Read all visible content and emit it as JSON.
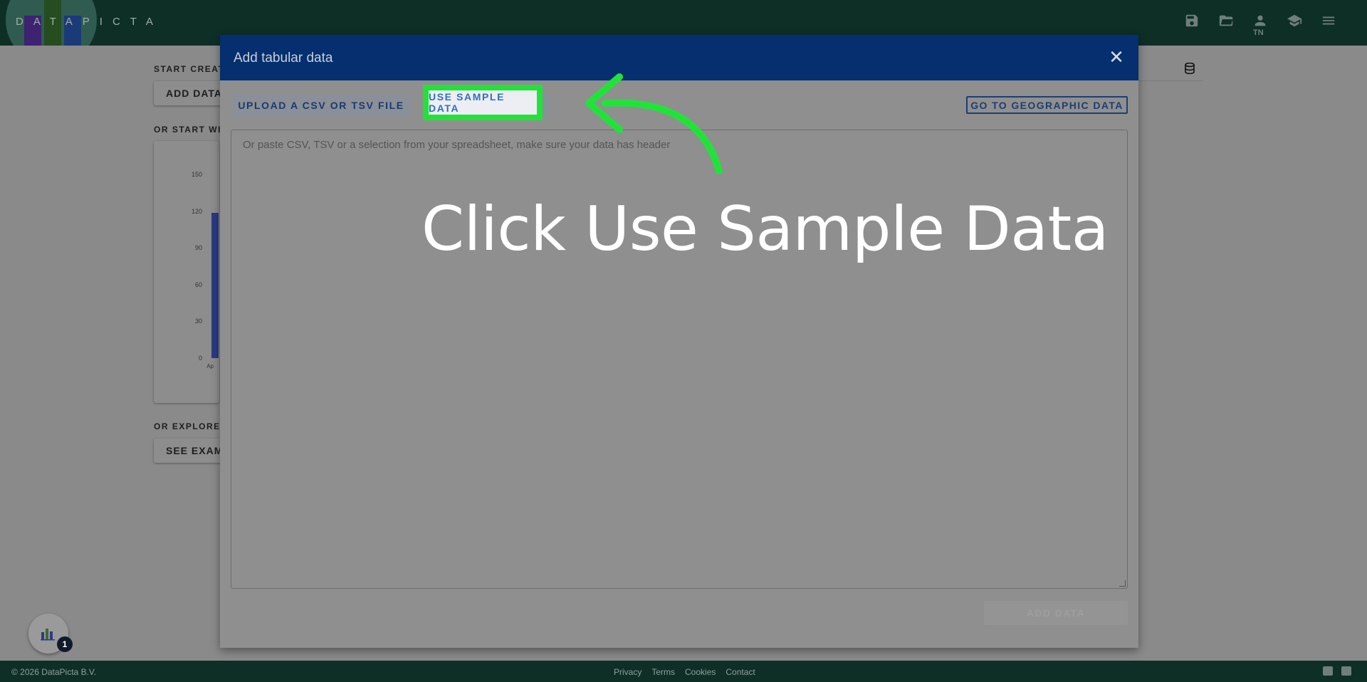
{
  "app": {
    "logo_text": "DATAPICTA",
    "icons": [
      "save-icon",
      "folder-open-icon",
      "account-icon",
      "school-icon",
      "menu-icon"
    ],
    "user_initials": "TN"
  },
  "background": {
    "start_label": "START CREAT",
    "add_data_label": "ADD DATA",
    "start_with_label": "OR START WI",
    "y_ticks": [
      "150",
      "120",
      "90",
      "60",
      "30",
      "0"
    ],
    "x_tick": "Ap",
    "explore_label": "OR EXPLORE",
    "see_examples_label": "SEE EXAM"
  },
  "modal": {
    "title": "Add tabular data",
    "close_glyph": "✕",
    "upload_label": "UPLOAD A CSV OR TSV FILE",
    "sample_label": "USE SAMPLE DATA",
    "geo_label": "GO TO GEOGRAPHIC DATA",
    "paste_placeholder": "Or paste CSV, TSV or a selection from your spreadsheet, make sure your data has header",
    "add_data_label": "ADD DATA"
  },
  "overlay": {
    "instruction": "Click Use Sample Data",
    "highlight_color": "#22e23a"
  },
  "chat": {
    "badge_count": "1"
  },
  "footer": {
    "copyright": "© 2026 DataPicta B.V.",
    "links": [
      "Privacy",
      "Terms",
      "Cookies",
      "Contact"
    ],
    "social": [
      "youtube-icon",
      "linkedin-icon"
    ]
  },
  "colors": {
    "topbar": "#0d2f25",
    "modal_header": "#052f6f",
    "accent": "#2e6fc0"
  }
}
